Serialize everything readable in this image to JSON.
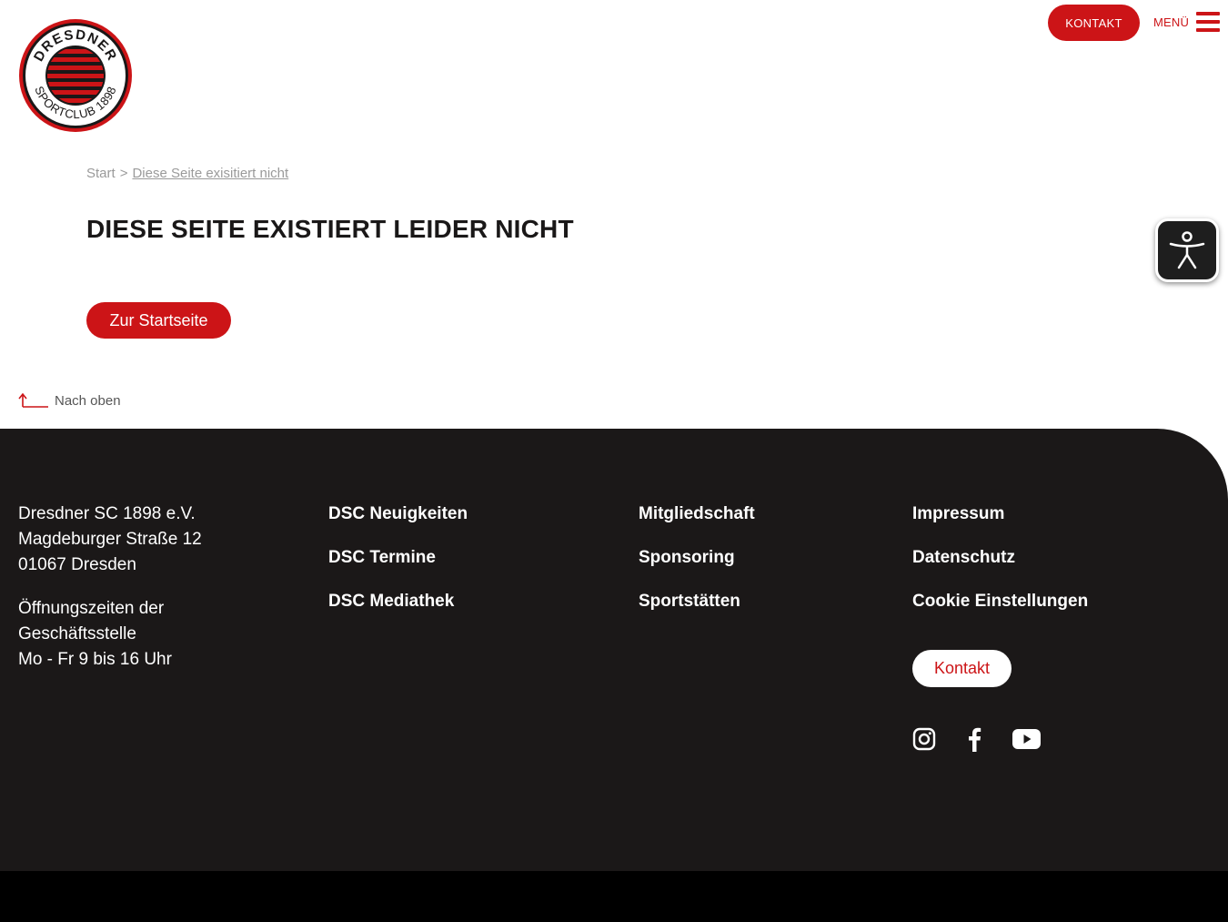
{
  "header": {
    "logo": {
      "top_text": "DRESDNER",
      "bottom_text": "SPORTCLUB 1898",
      "colors": {
        "red": "#cc1417",
        "black": "#1a1818"
      }
    },
    "kontakt_label": "KONTAKT",
    "menu_label": "MENÜ"
  },
  "breadcrumb": {
    "start": "Start",
    "separator": ">",
    "current": "Diese Seite exisitiert nicht"
  },
  "main": {
    "title": "DIESE SEITE EXISTIERT LEIDER NICHT",
    "start_button": "Zur Startseite"
  },
  "back_to_top": "Nach oben",
  "footer": {
    "address": {
      "line1": "Dresdner SC 1898 e.V.",
      "line2": "Magdeburger Straße 12",
      "line3": "01067 Dresden",
      "hours1": "Öffnungszeiten der",
      "hours2": "Geschäftsstelle",
      "hours3": "Mo - Fr 9 bis 16 Uhr"
    },
    "col2": [
      "DSC Neuigkeiten",
      "DSC Termine",
      "DSC Mediathek"
    ],
    "col3": [
      "Mitgliedschaft",
      "Sponsoring",
      "Sportstätten"
    ],
    "col4": [
      "Impressum",
      "Datenschutz",
      "Cookie Einstellungen"
    ],
    "kontakt_label": "Kontakt",
    "socials": [
      "instagram-icon",
      "facebook-icon",
      "youtube-icon"
    ]
  },
  "colors": {
    "accent": "#cc1417",
    "text": "#1a1818",
    "footer_bg": "#1b1818",
    "footer_bottom": "#000000"
  }
}
